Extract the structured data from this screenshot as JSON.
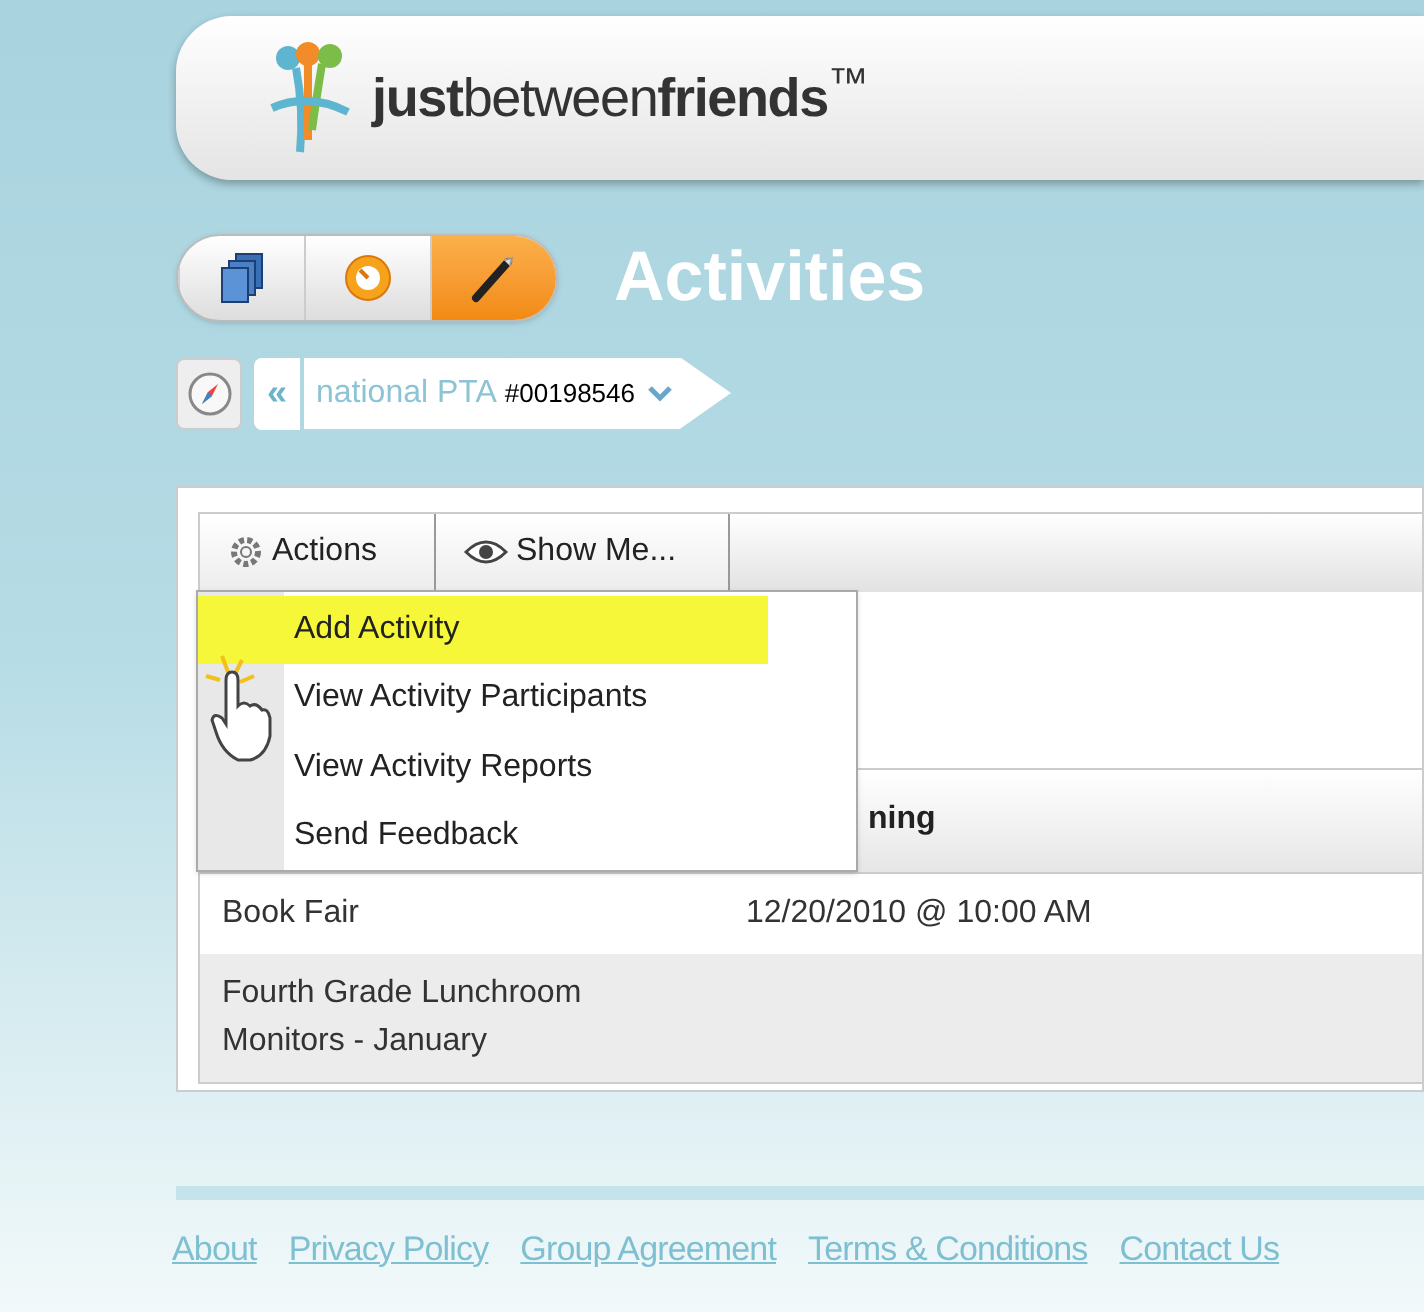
{
  "header": {
    "logo": "**just**between**friends**$^{™}$"
  },
  "mode_buttons": [
    {
      "kind": "pages",
      "selected": false
    },
    {
      "kind": "clock",
      "selected": false
    },
    {
      "kind": "pencil",
      "selected": true
    }
  ],
  "page_title": "Activities",
  "breadcrumb": {
    "back": "«",
    "group": "national PTA",
    "number": "#00198546"
  },
  "toolbar": {
    "tabs": [
      {
        "kind": "gear",
        "label": "Actions"
      },
      {
        "kind": "eye",
        "label": "Show Me..."
      }
    ]
  },
  "menu": {
    "items": [
      {
        "label": "Add Activity",
        "selected": true
      },
      {
        "label": "View Activity Participants",
        "selected": false
      },
      {
        "label": "View Activity Reports",
        "selected": false
      },
      {
        "label": "Send Feedback",
        "selected": false
      }
    ]
  },
  "table": {
    "column_2_heading": "ning",
    "rows": [
      {
        "column_1": "Book Fair",
        "column_2": "12/20/2010 @ 10:00 AM"
      },
      {
        "column_1": "Fourth Grade Lunchroom Monitors - January"
      }
    ]
  },
  "footer": {
    "links": [
      "About",
      "Privacy Policy",
      "Group Agreement",
      "Terms & Conditions",
      "Contact Us"
    ]
  }
}
